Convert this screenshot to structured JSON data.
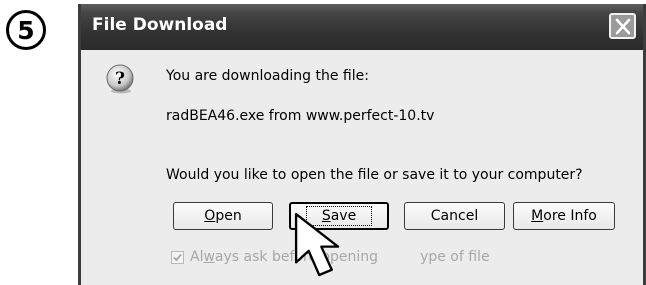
{
  "step": {
    "number": "5"
  },
  "dialog": {
    "title": "File Download",
    "close_icon": "close-icon",
    "question_icon": "question-icon",
    "line1": "You are downloading the file:",
    "filename_line": "radBEA46.exe from www.perfect-10.tv",
    "prompt": "Would you like to open the file or save it to your computer?",
    "buttons": {
      "open": {
        "mnemonic": "O",
        "rest": "pen"
      },
      "save": {
        "mnemonic": "S",
        "rest": "ave"
      },
      "cancel": {
        "label": "Cancel"
      },
      "more_info": {
        "mnemonic": "M",
        "rest": "ore Info"
      }
    },
    "checkbox": {
      "prefix": "Al",
      "mnemonic": "w",
      "rest": "ays ask before opening",
      "tail": "ype of file",
      "checked": true
    }
  },
  "colors": {
    "titlebar": "#333333",
    "dialog_bg": "#ececec",
    "disabled_text": "#a7a7a7"
  }
}
